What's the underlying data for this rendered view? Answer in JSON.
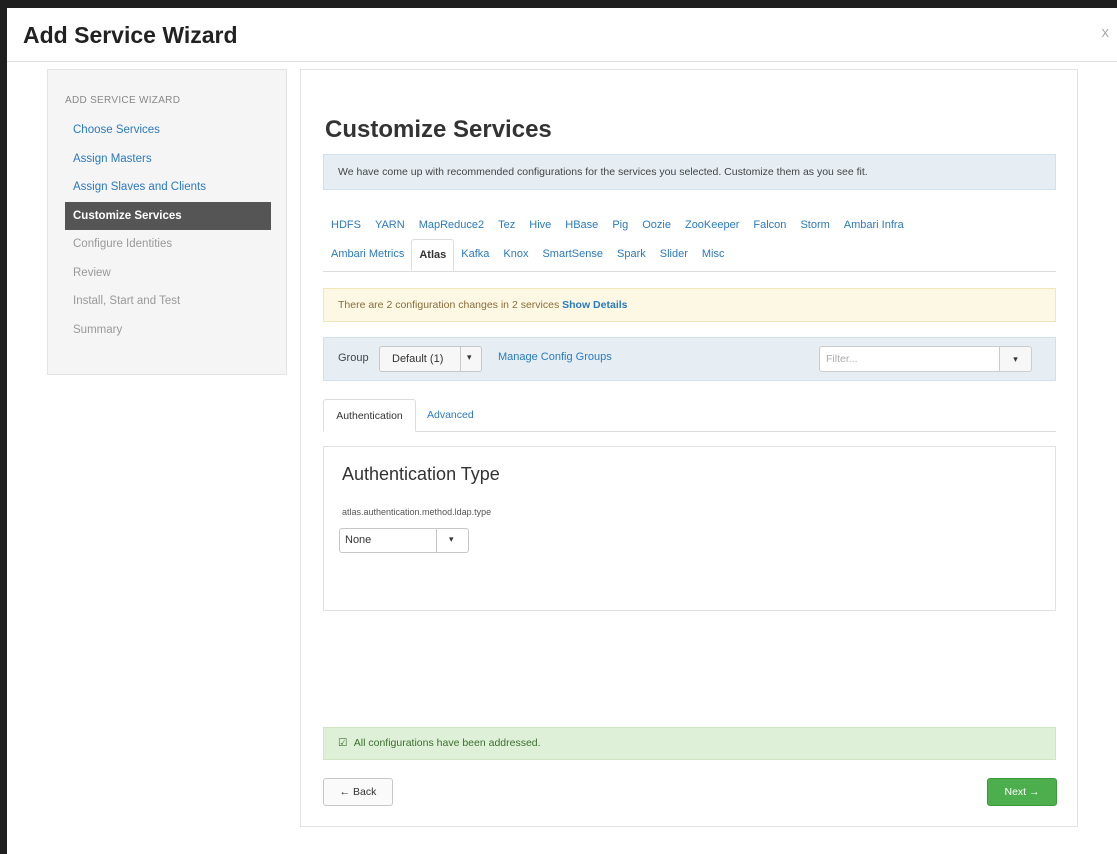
{
  "modal": {
    "title": "Add Service Wizard",
    "close": "x"
  },
  "sidebar": {
    "heading": "ADD SERVICE WIZARD",
    "steps": [
      {
        "label": "Choose Services",
        "state": "done"
      },
      {
        "label": "Assign Masters",
        "state": "done"
      },
      {
        "label": "Assign Slaves and Clients",
        "state": "done"
      },
      {
        "label": "Customize Services",
        "state": "active"
      },
      {
        "label": "Configure Identities",
        "state": "todo"
      },
      {
        "label": "Review",
        "state": "todo"
      },
      {
        "label": "Install, Start and Test",
        "state": "todo"
      },
      {
        "label": "Summary",
        "state": "todo"
      }
    ]
  },
  "main": {
    "title": "Customize Services",
    "info": "We have come up with recommended configurations for the services you selected. Customize them as you see fit.",
    "service_tabs_row1": [
      "HDFS",
      "YARN",
      "MapReduce2",
      "Tez",
      "Hive",
      "HBase",
      "Pig",
      "Oozie",
      "ZooKeeper",
      "Falcon",
      "Storm",
      "Ambari Infra"
    ],
    "service_tabs_row2": [
      "Ambari Metrics",
      "Atlas",
      "Kafka",
      "Knox",
      "SmartSense",
      "Spark",
      "Slider",
      "Misc"
    ],
    "active_service": "Atlas",
    "warning": {
      "text": "There are 2 configuration changes in 2 services",
      "link": "Show Details"
    },
    "group_bar": {
      "label": "Group",
      "selected": "Default (1)",
      "caret": "▾",
      "manage_link": "Manage Config Groups",
      "filter_placeholder": "Filter..."
    },
    "sub_tabs": {
      "active": "Authentication",
      "other": "Advanced"
    },
    "auth": {
      "title": "Authentication Type",
      "property": "atlas.authentication.method.ldap.type",
      "value": "None"
    },
    "success": {
      "icon": "☑",
      "text": "All configurations have been addressed."
    },
    "buttons": {
      "back": "← Back",
      "next": "Next →"
    }
  },
  "colors": {
    "link": "#2a7abf",
    "active_step_bg": "#555555",
    "next_button": "#4cae4c"
  }
}
